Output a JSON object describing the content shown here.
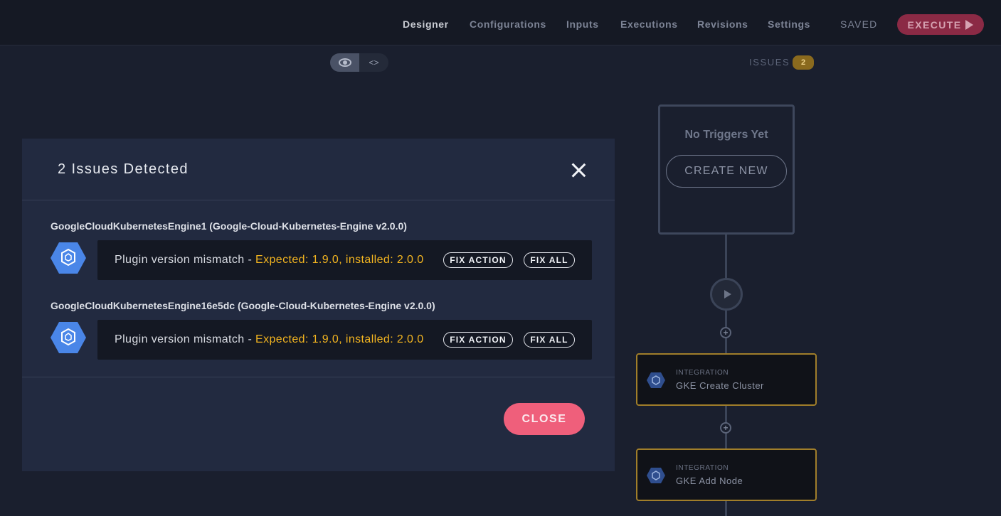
{
  "nav": {
    "items": [
      "Designer",
      "Configurations",
      "Inputs",
      "Executions",
      "Revisions",
      "Settings"
    ],
    "active": "Designer",
    "saved_label": "SAVED",
    "execute_label": "EXECUTE"
  },
  "view_toggle": {
    "code_label": "<>"
  },
  "issues": {
    "label": "ISSUES",
    "count": "2"
  },
  "canvas": {
    "trigger_title": "No Triggers Yet",
    "create_new_label": "CREATE NEW",
    "nodes": [
      {
        "kind": "INTEGRATION",
        "name": "GKE Create Cluster"
      },
      {
        "kind": "INTEGRATION",
        "name": "GKE Add Node"
      }
    ]
  },
  "modal": {
    "title": "2 Issues Detected",
    "groups": [
      {
        "title": "GoogleCloudKubernetesEngine1 (Google-Cloud-Kubernetes-Engine v2.0.0)",
        "message": "Plugin version mismatch - ",
        "detail": "Expected: 1.9.0, installed: 2.0.0",
        "fix_action_label": "FIX ACTION",
        "fix_all_label": "FIX ALL"
      },
      {
        "title": "GoogleCloudKubernetesEngine16e5dc (Google-Cloud-Kubernetes-Engine v2.0.0)",
        "message": "Plugin version mismatch - ",
        "detail": "Expected: 1.9.0, installed: 2.0.0",
        "fix_action_label": "FIX ACTION",
        "fix_all_label": "FIX ALL"
      }
    ],
    "close_label": "CLOSE"
  },
  "colors": {
    "background": "#1a1f2e",
    "modal": "#222a40",
    "warning": "#f2b420",
    "close_button": "#ef5f7b",
    "execute_button": "#8b2a45",
    "node_border": "#a07e2a",
    "gke_blue": "#4a86e8"
  },
  "icons": [
    "eye-icon",
    "close-icon",
    "play-icon",
    "plus-icon",
    "gke-hexagon-icon"
  ]
}
